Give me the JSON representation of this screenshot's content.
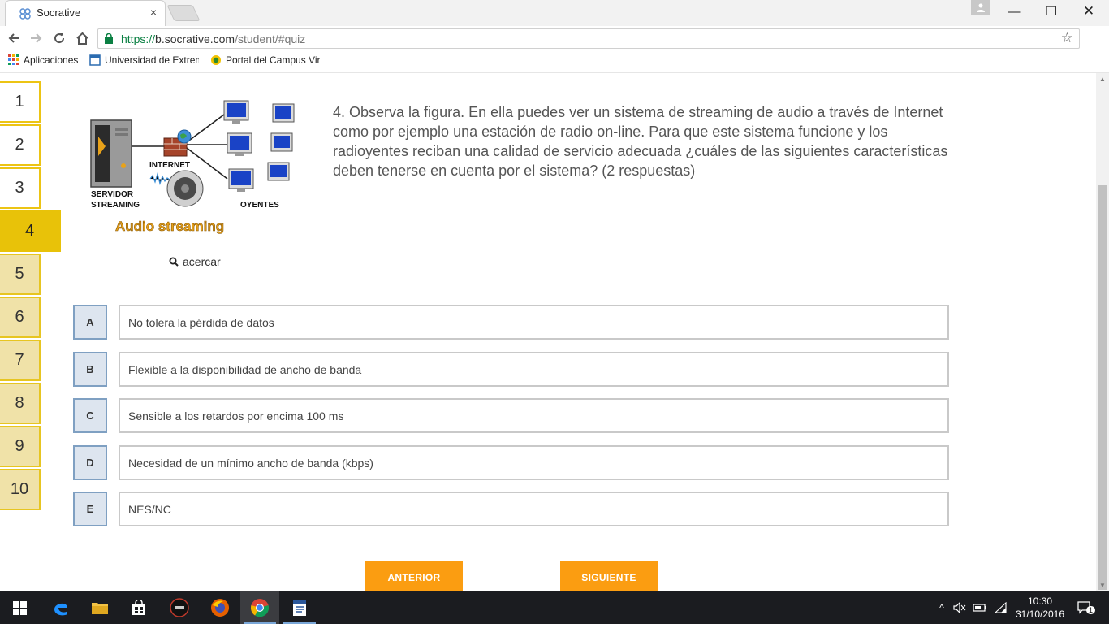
{
  "browser": {
    "tab_title": "Socrative",
    "tab_close": "×",
    "url_scheme": "https://",
    "url_host": "b.socrative.com",
    "url_path": "/student/#quiz",
    "window_controls": {
      "minimize": "—",
      "maximize": "❐",
      "close": "✕"
    },
    "bookmarks": [
      {
        "label": "Aplicaciones",
        "icon": "apps-grid-icon"
      },
      {
        "label": "Universidad de Extrem",
        "icon": "university-page-icon"
      },
      {
        "label": "Portal del Campus Vir",
        "icon": "campus-portal-icon"
      }
    ]
  },
  "quiz": {
    "nav": [
      "1",
      "2",
      "3",
      "4",
      "5",
      "6",
      "7",
      "8",
      "9",
      "10"
    ],
    "current": "4",
    "figure": {
      "servidor_line1": "SERVIDOR",
      "servidor_line2": "STREAMING",
      "internet": "INTERNET",
      "oyentes": "OYENTES",
      "caption": "Audio streaming"
    },
    "zoom_label": "acercar",
    "question_text": "4. Observa la figura. En ella puedes ver un sistema de streaming de audio a través de Internet como por ejemplo una estación de radio on-line. Para que este sistema funcione y los radioyentes reciban una calidad de servicio adecuada ¿cuáles de las siguientes características deben tenerse en cuenta por el sistema? (2 respuestas)",
    "answers": [
      {
        "letter": "A",
        "text": "No tolera la pérdida de datos"
      },
      {
        "letter": "B",
        "text": "Flexible a la disponibilidad de ancho de banda"
      },
      {
        "letter": "C",
        "text": "Sensible a los retardos por encima 100 ms"
      },
      {
        "letter": "D",
        "text": "Necesidad de un mínimo ancho de banda (kbps)"
      },
      {
        "letter": "E",
        "text": "NES/NC"
      }
    ],
    "prev_label": "ANTERIOR",
    "next_label": "SIGUIENTE"
  },
  "taskbar": {
    "clock_time": "10:30",
    "clock_date": "31/10/2016",
    "notification_count": "1"
  },
  "colors": {
    "nav_fill": "#f0e2a8",
    "nav_border": "#e7c521",
    "nav_active": "#e8c209",
    "answer_letter_bg": "#dde5ef",
    "answer_letter_border": "#7fa0c2",
    "button_orange": "#fb9d11"
  }
}
